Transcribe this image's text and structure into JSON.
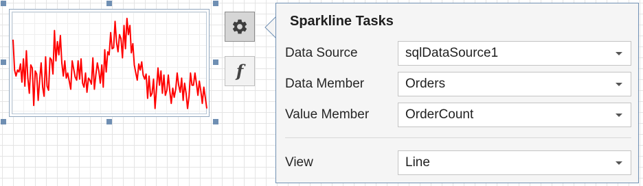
{
  "colors": {
    "accent": "#6f8fb3",
    "sparkline": "#ff0000",
    "panel_background": "#f5f5f5"
  },
  "side_buttons": {
    "tasks_icon": "gear-icon",
    "expression_icon": "function-icon",
    "expression_glyph": "f"
  },
  "sparkline_tasks": {
    "title": "Sparkline Tasks",
    "fields": [
      {
        "label": "Data Source",
        "value": "sqlDataSource1"
      },
      {
        "label": "Data Member",
        "value": "Orders"
      },
      {
        "label": "Value Member",
        "value": "OrderCount"
      },
      {
        "label": "View",
        "value": "Line"
      }
    ]
  },
  "sparkline_preview": {
    "values": [
      0.73,
      0.43,
      0.37,
      0.43,
      0.41,
      0.49,
      0.31,
      0.54,
      0.27,
      0.62,
      0.35,
      0.2,
      0.48,
      0.45,
      0.08,
      0.42,
      0.39,
      0.13,
      0.33,
      0.5,
      0.26,
      0.17,
      0.56,
      0.27,
      0.23,
      0.55,
      0.53,
      0.39,
      0.82,
      0.52,
      0.71,
      0.58,
      0.77,
      0.5,
      0.37,
      0.52,
      0.35,
      0.4,
      0.32,
      0.24,
      0.52,
      0.44,
      0.36,
      0.33,
      0.52,
      0.34,
      0.54,
      0.3,
      0.26,
      0.4,
      0.21,
      0.35,
      0.33,
      0.29,
      0.55,
      0.24,
      0.38,
      0.5,
      0.42,
      0.3,
      0.48,
      0.26,
      0.63,
      0.41,
      0.61,
      0.58,
      0.8,
      0.64,
      0.65,
      0.91,
      0.7,
      0.61,
      0.78,
      0.74,
      0.55,
      0.87,
      0.64,
      0.94,
      0.78,
      0.87,
      0.6,
      0.69,
      0.48,
      0.4,
      0.33,
      0.49,
      0.43,
      0.51,
      0.38,
      0.34,
      0.39,
      0.15,
      0.37,
      0.17,
      0.2,
      0.34,
      0.05,
      0.24,
      0.45,
      0.28,
      0.42,
      0.2,
      0.38,
      0.18,
      0.23,
      0.38,
      0.22,
      0.1,
      0.25,
      0.16,
      0.24,
      0.4,
      0.28,
      0.21,
      0.35,
      0.13,
      0.3,
      0.2,
      0.05,
      0.17,
      0.4,
      0.28,
      0.28,
      0.4,
      0.3,
      0.18,
      0.32,
      0.22,
      0.1,
      0.26,
      0.16,
      0.05
    ]
  }
}
